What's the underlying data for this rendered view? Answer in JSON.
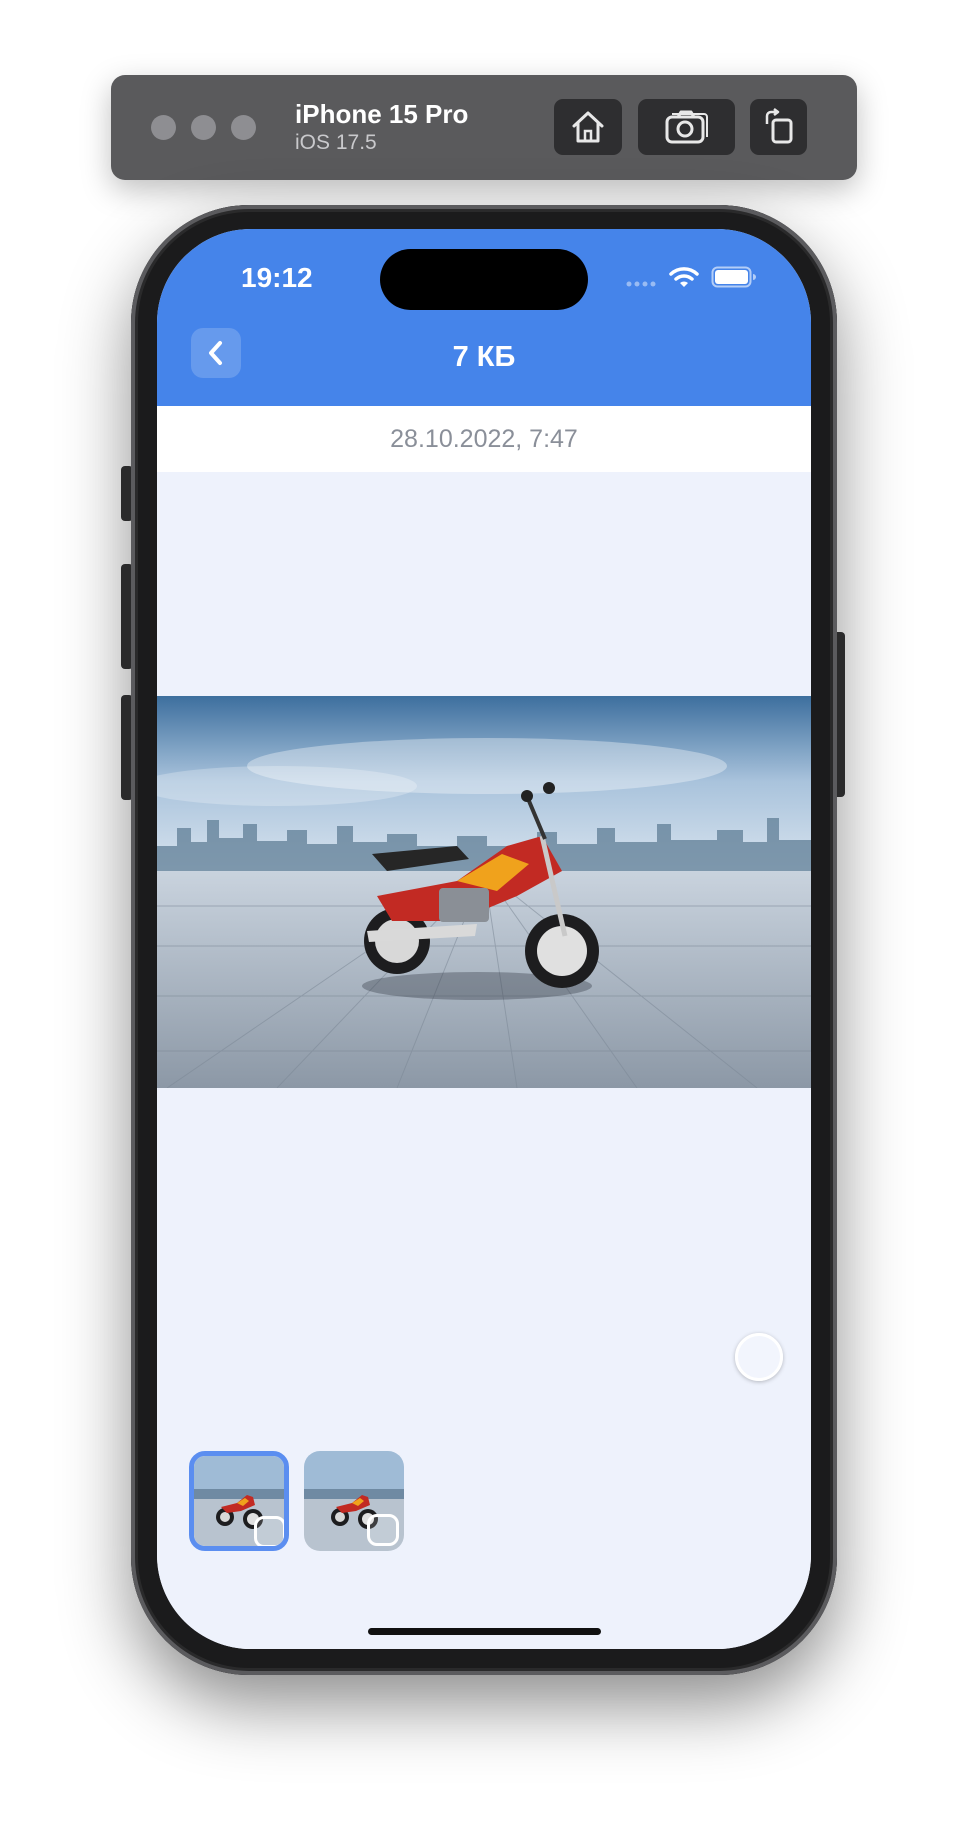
{
  "simulator": {
    "device_name": "iPhone 15 Pro",
    "os_version": "iOS 17.5",
    "buttons": [
      {
        "icon": "home-icon"
      },
      {
        "icon": "camera-icon"
      },
      {
        "icon": "rotate-icon"
      }
    ]
  },
  "status_bar": {
    "time": "19:12",
    "icons": [
      "signal-icon",
      "wifi-icon",
      "battery-icon"
    ]
  },
  "header": {
    "title": "7 КБ",
    "back_icon": "chevron-left-icon"
  },
  "date": "28.10.2022, 7:47",
  "viewer": {
    "image_subject": "red motorcycle on paved plaza with city skyline",
    "thumbnails": [
      {
        "selected": true
      },
      {
        "selected": false
      }
    ]
  },
  "colors": {
    "header": "#4584ea",
    "background": "#eef2fc",
    "selected_border": "#5b8ef0"
  }
}
